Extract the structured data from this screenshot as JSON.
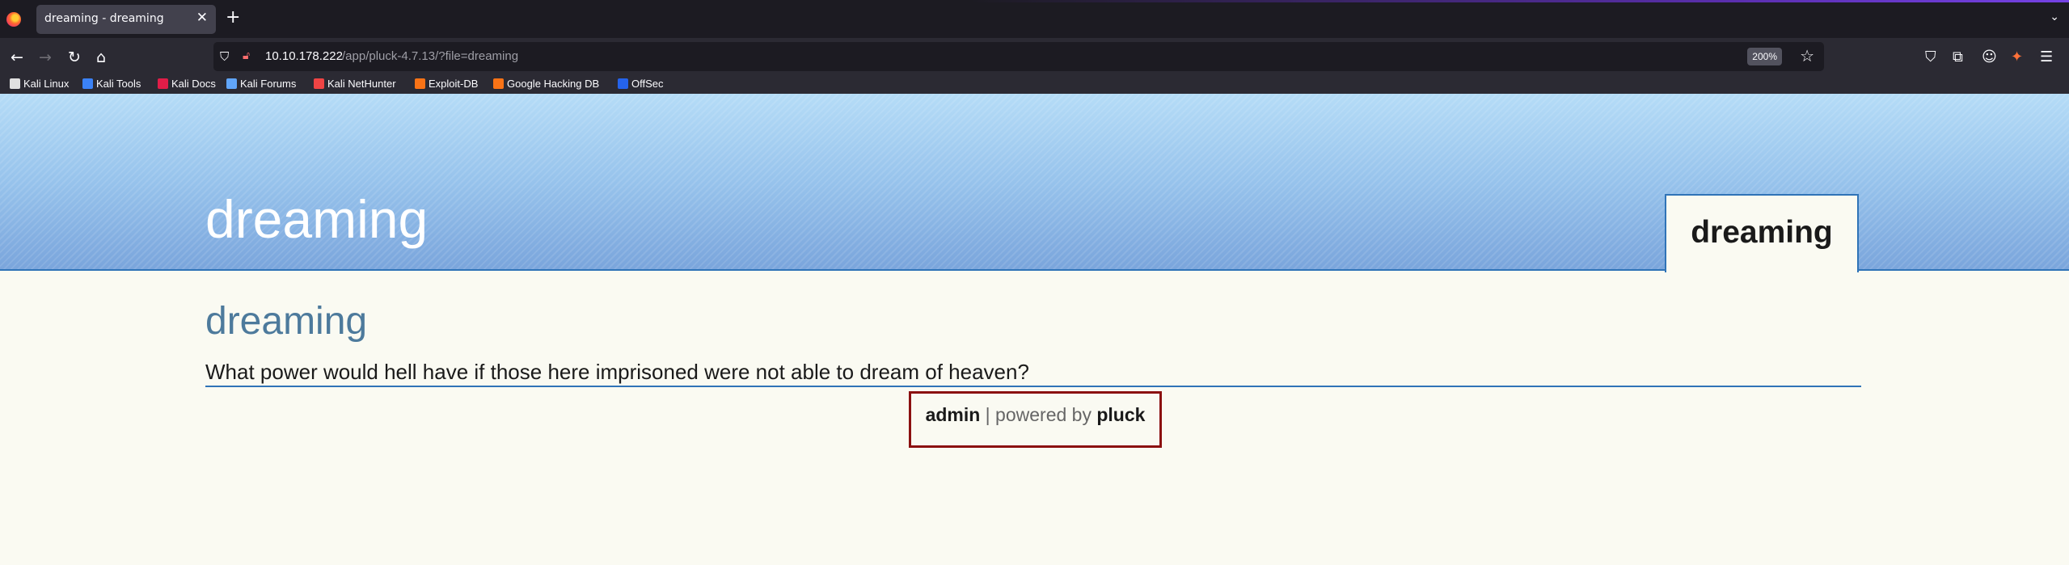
{
  "browser": {
    "tab": {
      "title": "dreaming - dreaming",
      "close_glyph": "✕"
    },
    "new_tab_glyph": "+",
    "tab_list_glyph": "⌄",
    "url": {
      "host": "10.10.178.222",
      "path": "/app/pluck-4.7.13/?file=dreaming"
    },
    "zoom": "200%",
    "icons": {
      "back": "back-arrow-icon",
      "forward": "forward-arrow-icon",
      "reload": "reload-icon",
      "home": "home-icon",
      "shield": "tracking-protection-shield-icon",
      "lock": "insecure-lock-icon",
      "star": "bookmark-star-icon",
      "pocket": "pocket-icon",
      "extensions": "extensions-icon",
      "account": "account-icon",
      "addon": "addon-fox-icon",
      "menu": "hamburger-menu-icon"
    },
    "bookmarks": [
      {
        "label": "Kali Linux",
        "color": "#e0e0e0"
      },
      {
        "label": "Kali Tools",
        "color": "#3b82f6"
      },
      {
        "label": "Kali Docs",
        "color": "#e11d48"
      },
      {
        "label": "Kali Forums",
        "color": "#60a5fa"
      },
      {
        "label": "Kali NetHunter",
        "color": "#ef4444"
      },
      {
        "label": "Exploit-DB",
        "color": "#f97316"
      },
      {
        "label": "Google Hacking DB",
        "color": "#f97316"
      },
      {
        "label": "OffSec",
        "color": "#2563eb"
      }
    ]
  },
  "page": {
    "site_title": "dreaming",
    "nav_tab": "dreaming",
    "content_title": "dreaming",
    "content_text": "What power would hell have if those here imprisoned were not able to dream of heaven?",
    "footer": {
      "admin": "admin",
      "separator": " | powered by ",
      "pluck": "pluck"
    }
  },
  "colors": {
    "header_link": "#2f73b7",
    "content_title": "#4d7a9c",
    "footer_border": "#8b1010"
  }
}
